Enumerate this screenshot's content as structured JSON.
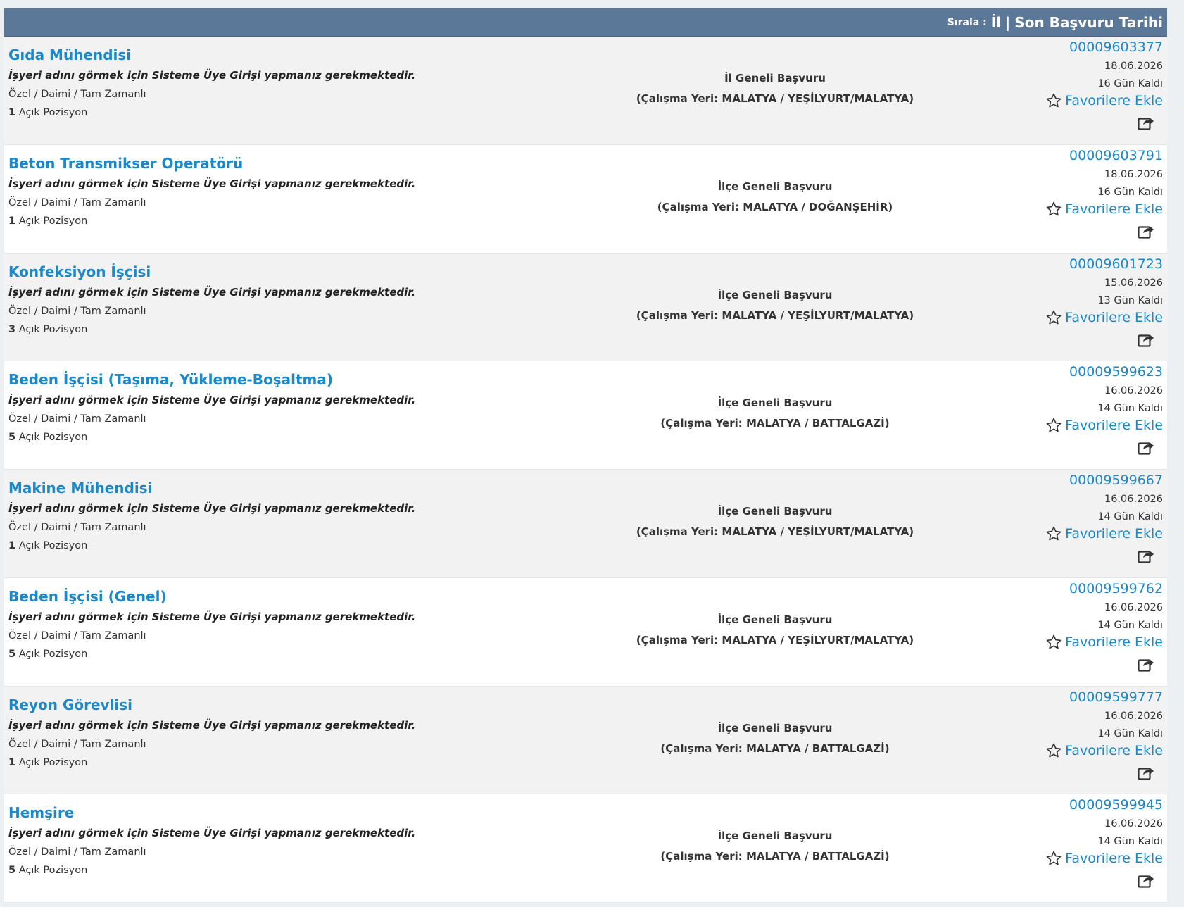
{
  "sort": {
    "label": "Sırala :",
    "options": [
      "İl",
      "Son Başvuru Tarihi"
    ],
    "separator": "|"
  },
  "common": {
    "employer_note": "İşyeri adını görmek için Sisteme Üye Girişi yapmanız gerekmektedir.",
    "favorites_label": "Favorilere Ekle",
    "positions_suffix": "Açık Pozisyon"
  },
  "jobs": [
    {
      "title": "Gıda Mühendisi",
      "employer_note": "İşyeri adını görmek için Sisteme Üye Girişi yapmanız gerekmektedir.",
      "job_type": "Özel / Daimi / Tam Zamanlı",
      "positions_count": "1",
      "positions_label": "Açık Pozisyon",
      "scope": "İl Geneli Başvuru",
      "location": "(Çalışma Yeri: MALATYA / YEŞİLYURT/MALATYA)",
      "ilan_no": "00009603377",
      "deadline": "18.06.2026",
      "days_left": "16 Gün Kaldı",
      "favorites_label": "Favorilere Ekle"
    },
    {
      "title": "Beton Transmikser Operatörü",
      "employer_note": "İşyeri adını görmek için Sisteme Üye Girişi yapmanız gerekmektedir.",
      "job_type": "Özel / Daimi / Tam Zamanlı",
      "positions_count": "1",
      "positions_label": "Açık Pozisyon",
      "scope": "İlçe Geneli Başvuru",
      "location": "(Çalışma Yeri: MALATYA / DOĞANŞEHİR)",
      "ilan_no": "00009603791",
      "deadline": "18.06.2026",
      "days_left": "16 Gün Kaldı",
      "favorites_label": "Favorilere Ekle"
    },
    {
      "title": "Konfeksiyon İşçisi",
      "employer_note": "İşyeri adını görmek için Sisteme Üye Girişi yapmanız gerekmektedir.",
      "job_type": "Özel / Daimi / Tam Zamanlı",
      "positions_count": "3",
      "positions_label": "Açık Pozisyon",
      "scope": "İlçe Geneli Başvuru",
      "location": "(Çalışma Yeri: MALATYA / YEŞİLYURT/MALATYA)",
      "ilan_no": "00009601723",
      "deadline": "15.06.2026",
      "days_left": "13 Gün Kaldı",
      "favorites_label": "Favorilere Ekle"
    },
    {
      "title": "Beden İşçisi (Taşıma, Yükleme-Boşaltma)",
      "employer_note": "İşyeri adını görmek için Sisteme Üye Girişi yapmanız gerekmektedir.",
      "job_type": "Özel / Daimi / Tam Zamanlı",
      "positions_count": "5",
      "positions_label": "Açık Pozisyon",
      "scope": "İlçe Geneli Başvuru",
      "location": "(Çalışma Yeri: MALATYA / BATTALGAZİ)",
      "ilan_no": "00009599623",
      "deadline": "16.06.2026",
      "days_left": "14 Gün Kaldı",
      "favorites_label": "Favorilere Ekle"
    },
    {
      "title": "Makine Mühendisi",
      "employer_note": "İşyeri adını görmek için Sisteme Üye Girişi yapmanız gerekmektedir.",
      "job_type": "Özel / Daimi / Tam Zamanlı",
      "positions_count": "1",
      "positions_label": "Açık Pozisyon",
      "scope": "İlçe Geneli Başvuru",
      "location": "(Çalışma Yeri: MALATYA / YEŞİLYURT/MALATYA)",
      "ilan_no": "00009599667",
      "deadline": "16.06.2026",
      "days_left": "14 Gün Kaldı",
      "favorites_label": "Favorilere Ekle"
    },
    {
      "title": "Beden İşçisi (Genel)",
      "employer_note": "İşyeri adını görmek için Sisteme Üye Girişi yapmanız gerekmektedir.",
      "job_type": "Özel / Daimi / Tam Zamanlı",
      "positions_count": "5",
      "positions_label": "Açık Pozisyon",
      "scope": "İlçe Geneli Başvuru",
      "location": "(Çalışma Yeri: MALATYA / YEŞİLYURT/MALATYA)",
      "ilan_no": "00009599762",
      "deadline": "16.06.2026",
      "days_left": "14 Gün Kaldı",
      "favorites_label": "Favorilere Ekle"
    },
    {
      "title": "Reyon Görevlisi",
      "employer_note": "İşyeri adını görmek için Sisteme Üye Girişi yapmanız gerekmektedir.",
      "job_type": "Özel / Daimi / Tam Zamanlı",
      "positions_count": "1",
      "positions_label": "Açık Pozisyon",
      "scope": "İlçe Geneli Başvuru",
      "location": "(Çalışma Yeri: MALATYA / BATTALGAZİ)",
      "ilan_no": "00009599777",
      "deadline": "16.06.2026",
      "days_left": "14 Gün Kaldı",
      "favorites_label": "Favorilere Ekle"
    },
    {
      "title": "Hemşire",
      "employer_note": "İşyeri adını görmek için Sisteme Üye Girişi yapmanız gerekmektedir.",
      "job_type": "Özel / Daimi / Tam Zamanlı",
      "positions_count": "5",
      "positions_label": "Açık Pozisyon",
      "scope": "İlçe Geneli Başvuru",
      "location": "(Çalışma Yeri: MALATYA / BATTALGAZİ)",
      "ilan_no": "00009599945",
      "deadline": "16.06.2026",
      "days_left": "14 Gün Kaldı",
      "favorites_label": "Favorilere Ekle"
    }
  ],
  "colors": {
    "header_bar": "#5b7899",
    "link_blue": "#1a88c9",
    "row_alt": "#f2f2f2",
    "row_white": "#ffffff"
  },
  "icons": {
    "favorite": "star-outline-icon",
    "share": "share-icon"
  }
}
